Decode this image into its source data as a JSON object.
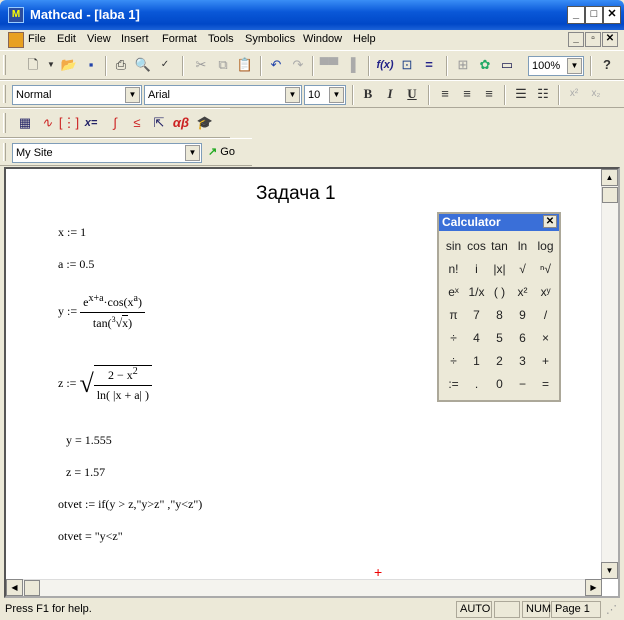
{
  "window": {
    "title": "Mathcad - [laba 1]",
    "app_icon": "M"
  },
  "menu": {
    "items": [
      "File",
      "Edit",
      "View",
      "Insert",
      "Format",
      "Tools",
      "Symbolics",
      "Window",
      "Help"
    ]
  },
  "toolbar_standard": {
    "zoom": "100%"
  },
  "toolbar_format": {
    "style": "Normal",
    "font": "Arial",
    "size": "10",
    "bold": "B",
    "italic": "I",
    "underline": "U",
    "superscript": "x²",
    "subscript": "x₂"
  },
  "toolbar_math": {
    "xeq": "x=",
    "greek": "αβ"
  },
  "toolbar_resources": {
    "site": "My Site",
    "go": "Go"
  },
  "worksheet": {
    "heading": "Задача 1",
    "x_def": "x := 1",
    "a_def": "a := 0.5",
    "y_lhs": "y :=",
    "y_num_exp": "x+a",
    "y_num_cos": "·cos",
    "y_num_arg": "x",
    "y_num_argexp": "a",
    "y_den": "tan",
    "y_den_root": "3",
    "y_den_arg": "x",
    "z_lhs": "z :=",
    "z_num": "2 − x",
    "z_num_exp": "2",
    "z_den": "ln( |x + a| )",
    "y_result": "y = 1.555",
    "z_result": "z = 1.57",
    "otvet_def": "otvet := if(y > z,\"y>z\" ,\"y<z\")",
    "otvet_result": "otvet = \"y<z\""
  },
  "calculator": {
    "title": "Calculator",
    "buttons": [
      "sin",
      "cos",
      "tan",
      "ln",
      "log",
      "n!",
      "i",
      "|x|",
      "√",
      "ⁿ√",
      "eˣ",
      "1/x",
      "( )",
      "x²",
      "xʸ",
      "π",
      "7",
      "8",
      "9",
      "/",
      "÷",
      "4",
      "5",
      "6",
      "×",
      "÷",
      "1",
      "2",
      "3",
      "+",
      ":=",
      ".",
      "0",
      "−",
      "="
    ]
  },
  "status": {
    "help": "Press F1 for help.",
    "mode": "AUTO",
    "num": "NUM",
    "page": "Page 1"
  }
}
